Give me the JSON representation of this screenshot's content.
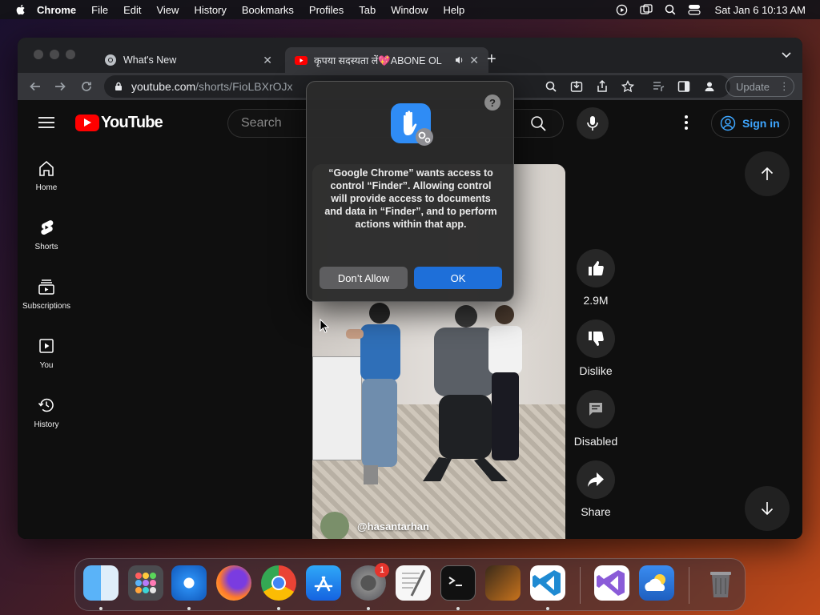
{
  "menubar": {
    "app_name": "Chrome",
    "items": [
      "File",
      "Edit",
      "View",
      "History",
      "Bookmarks",
      "Profiles",
      "Tab",
      "Window",
      "Help"
    ],
    "clock": "Sat Jan 6  10:13 AM"
  },
  "browser": {
    "tabs": [
      {
        "title": "What's New"
      },
      {
        "title": "कृपया सदस्यता लें💖ABONE OL"
      }
    ],
    "url_host": "youtube.com",
    "url_path": "/shorts/FioLBXrOJx",
    "update_label": "Update"
  },
  "youtube": {
    "logo_text": "YouTube",
    "search_placeholder": "Search",
    "signin_label": "Sign in",
    "sidebar": [
      {
        "label": "Home",
        "icon": "home-icon"
      },
      {
        "label": "Shorts",
        "icon": "shorts-icon"
      },
      {
        "label": "Subscriptions",
        "icon": "subscriptions-icon"
      },
      {
        "label": "You",
        "icon": "you-icon"
      },
      {
        "label": "History",
        "icon": "history-icon"
      }
    ],
    "short": {
      "channel": "@hasantarhan",
      "likes": "2.9M",
      "dislike_label": "Dislike",
      "comments_label": "Disabled",
      "share_label": "Share"
    }
  },
  "dialog": {
    "message": "“Google Chrome” wants access to control “Finder”. Allowing control will provide access to documents and data in “Finder”, and to perform actions within that app.",
    "deny_label": "Don’t Allow",
    "ok_label": "OK",
    "help_label": "?"
  },
  "dock": {
    "notification_badge": "1",
    "apps": [
      "Finder",
      "Launchpad",
      "Safari",
      "Firefox",
      "Chrome",
      "App Store",
      "System Settings",
      "TextEdit",
      "Terminal",
      "GarageBand",
      "VS Code",
      "Visual Studio",
      "Weather",
      "Trash"
    ]
  },
  "colors": {
    "youtube_red": "#ff0000",
    "link_blue": "#3ea6ff",
    "dialog_ok": "#1e6fd9"
  }
}
